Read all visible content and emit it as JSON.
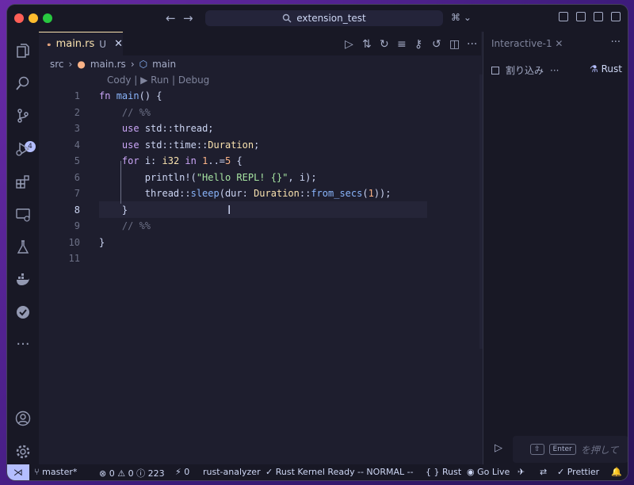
{
  "window": {
    "title": "extension_test"
  },
  "titlebar": {
    "search_text": "extension_test",
    "back_icon": "←",
    "forward_icon": "→"
  },
  "activity": {
    "scm_badge": "4"
  },
  "tabs": [
    {
      "label": "main.rs",
      "status": "U"
    }
  ],
  "breadcrumb": {
    "folder": "src",
    "file": "main.rs",
    "symbol": "main"
  },
  "codelens": "Cody | ▶ Run | Debug",
  "editor": {
    "line_numbers": [
      "1",
      "2",
      "3",
      "4",
      "5",
      "6",
      "7",
      "8",
      "9",
      "10",
      "11"
    ],
    "lines": [
      "fn main() {",
      "    // %%",
      "    use std::thread;",
      "    use std::time::Duration;",
      "    for i: i32 in 1..=5 {",
      "        println!(\"Hello REPL! {}\", i);",
      "        thread::sleep(dur: Duration::from_secs(1));",
      "    }",
      "    // %%",
      "}",
      ""
    ],
    "current_line": 8
  },
  "panel": {
    "tab_label": "Interactive-1",
    "interrupt_label": "割り込み",
    "more_label": "···",
    "kernel_label": "Rust",
    "input_kbd_shift": "⇧",
    "input_kbd_enter": "Enter",
    "input_hint": "を押して"
  },
  "status": {
    "branch": "master*",
    "errors": "0",
    "warnings": "0",
    "info": "223",
    "ports": "0",
    "analyzer": "rust-analyzer",
    "kernel": "Rust Kernel Ready",
    "mode": "-- NORMAL --",
    "language": "Rust",
    "golive": "Go Live",
    "prettier": "Prettier"
  }
}
